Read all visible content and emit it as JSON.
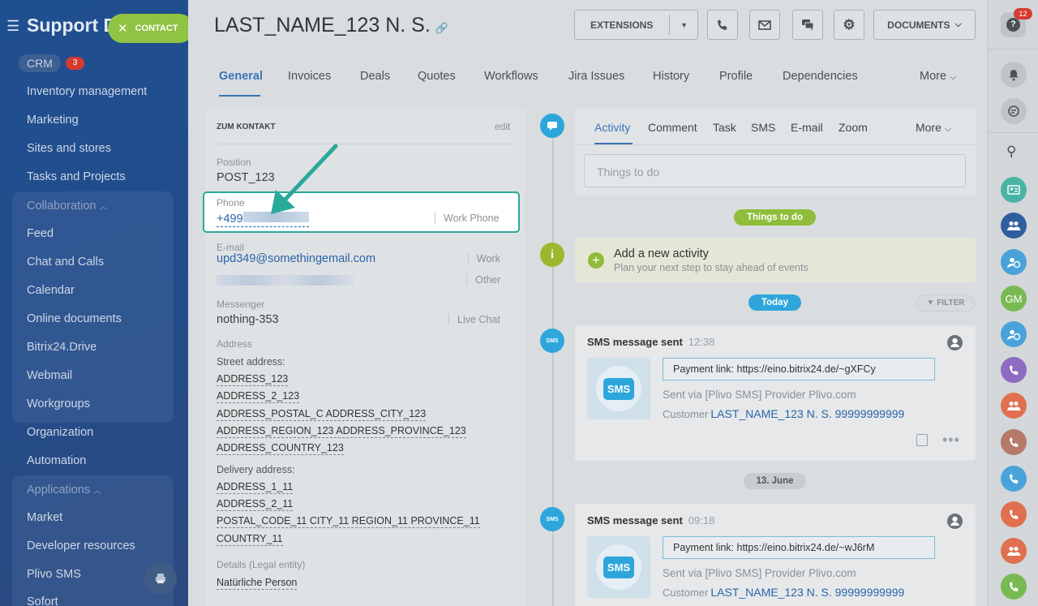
{
  "sidebar": {
    "title": "Support D",
    "contact_button": "CONTACT",
    "crm_label": "CRM",
    "crm_count": "3",
    "items": [
      {
        "label": "Inventory management"
      },
      {
        "label": "Marketing"
      },
      {
        "label": "Sites and stores"
      },
      {
        "label": "Tasks and Projects"
      },
      {
        "label": "Collaboration"
      },
      {
        "label": "Feed"
      },
      {
        "label": "Chat and Calls"
      },
      {
        "label": "Calendar"
      },
      {
        "label": "Online documents"
      },
      {
        "label": "Bitrix24.Drive"
      },
      {
        "label": "Webmail"
      },
      {
        "label": "Workgroups"
      },
      {
        "label": "Organization"
      },
      {
        "label": "Automation"
      },
      {
        "label": "Applications"
      },
      {
        "label": "Market"
      },
      {
        "label": "Developer resources"
      },
      {
        "label": "Plivo SMS"
      },
      {
        "label": "Sofort"
      }
    ]
  },
  "header": {
    "contact_name": "LAST_NAME_123 N. S.",
    "extensions": "EXTENSIONS",
    "documents": "DOCUMENTS"
  },
  "tabs": [
    "General",
    "Invoices",
    "Deals",
    "Quotes",
    "Workflows",
    "Jira Issues",
    "History",
    "Profile",
    "Dependencies",
    "More"
  ],
  "details": {
    "section_title": "ZUM KONTAKT",
    "edit": "edit",
    "position_label": "Position",
    "position": "POST_123",
    "phone_label": "Phone",
    "phone": "+499",
    "phone_type": "Work Phone",
    "email_label": "E-mail",
    "email": "upd349@somethingemail.com",
    "email_type": "Work",
    "email2_type": "Other",
    "messenger_label": "Messenger",
    "messenger": "nothing-353",
    "messenger_type": "Live Chat",
    "address_label": "Address",
    "street_label": "Street address:",
    "street": [
      "ADDRESS_123",
      "ADDRESS_2_123",
      "ADDRESS_POSTAL_C ADDRESS_CITY_123",
      "ADDRESS_REGION_123 ADDRESS_PROVINCE_123",
      "ADDRESS_COUNTRY_123"
    ],
    "delivery_label": "Delivery address:",
    "delivery": [
      "ADDRESS_1_11",
      "ADDRESS_2_11",
      "POSTAL_CODE_11 CITY_11 REGION_11 PROVINCE_11",
      "COUNTRY_11"
    ],
    "details_label": "Details (Legal entity)",
    "details_value": "Natürliche Person"
  },
  "activity": {
    "tabs": [
      "Activity",
      "Comment",
      "Task",
      "SMS",
      "E-mail",
      "Zoom",
      "More"
    ],
    "placeholder": "Things to do",
    "things_pill": "Things to do",
    "add_title": "Add a new activity",
    "add_sub": "Plan your next step to stay ahead of events",
    "today_pill": "Today",
    "filter": "FILTER",
    "date_pill": "13. June"
  },
  "feed": [
    {
      "title": "SMS message sent",
      "time": "12:38",
      "sms": "SMS",
      "payment": "Payment link: https://eino.bitrix24.de/~gXFCy",
      "sent_via": "Sent via [Plivo SMS] Provider Plivo.com",
      "customer_label": "Customer",
      "customer": "LAST_NAME_123 N. S. 99999999999"
    },
    {
      "title": "SMS message sent",
      "time": "09:18",
      "sms": "SMS",
      "payment": "Payment link: https://eino.bitrix24.de/~wJ6rM",
      "sent_via": "Sent via [Plivo SMS] Provider Plivo.com",
      "customer_label": "Customer",
      "customer": "LAST_NAME_123 N. S. 99999999999"
    }
  ],
  "rail": {
    "help_count": "12",
    "avatar_initials": "GM"
  },
  "colors": {
    "accent": "#3b73b7",
    "highlight": "#29a99a",
    "green": "#8fc341",
    "sms_blue": "#2ea6dc"
  }
}
